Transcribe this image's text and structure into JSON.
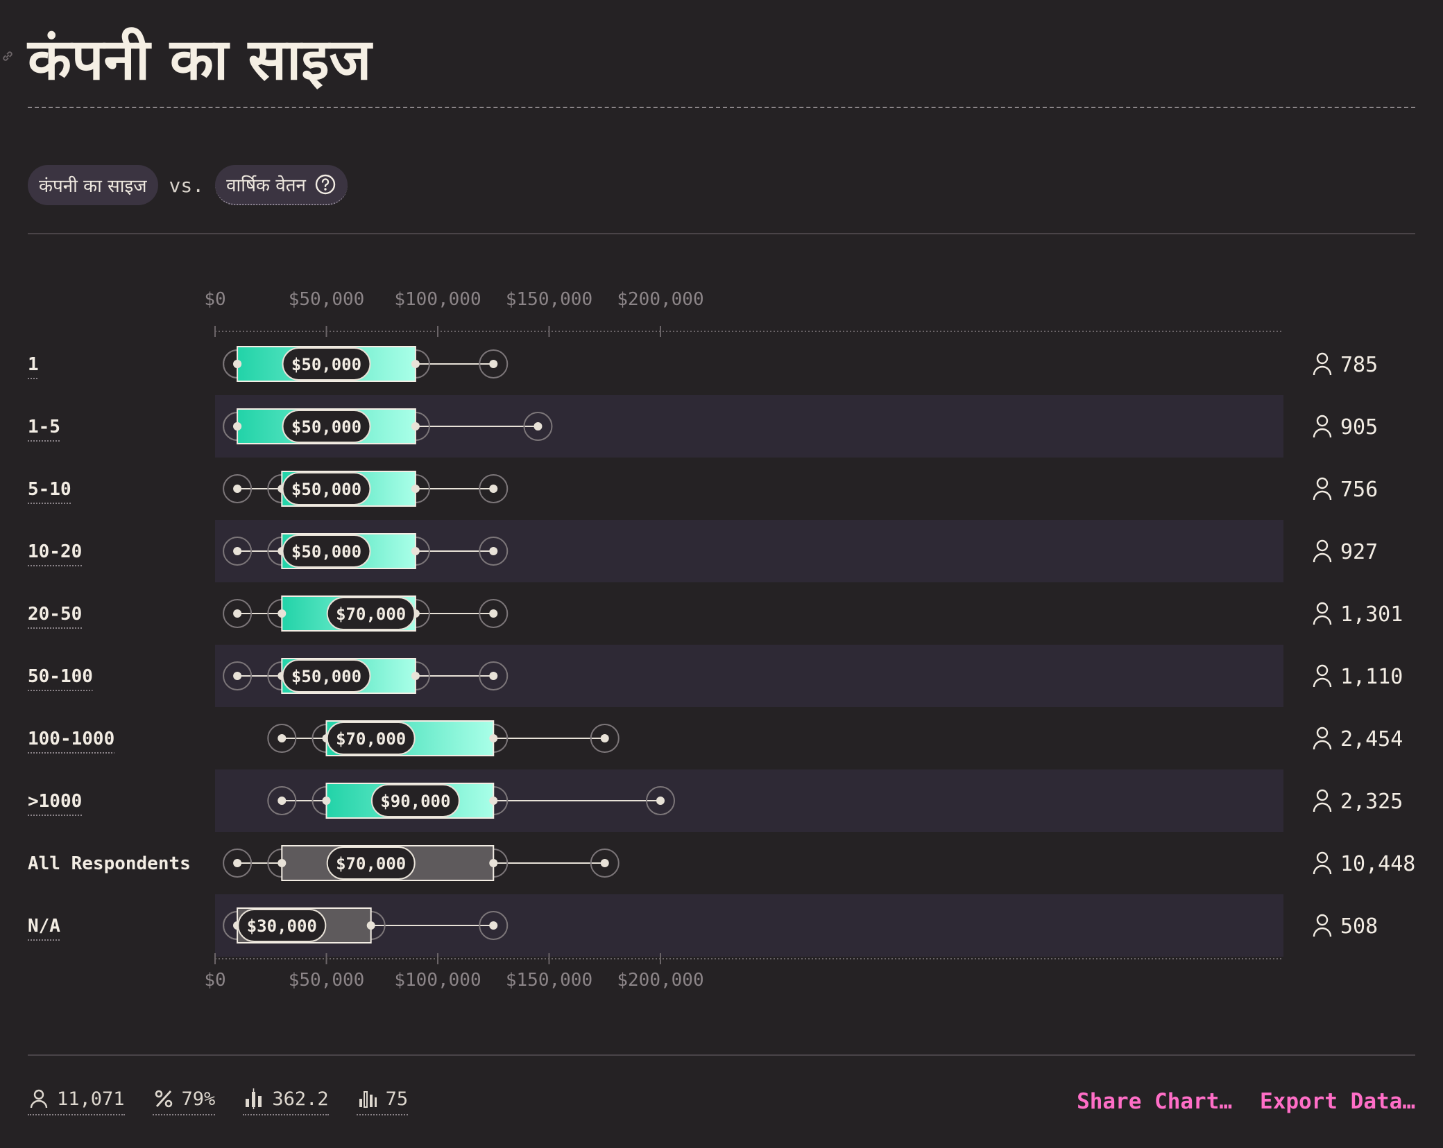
{
  "title": "कंपनी का साइज",
  "selector": {
    "category_label": "कंपनी का साइज",
    "vs": "vs.",
    "metric_label": "वार्षिक वेतन"
  },
  "colors": {
    "background": "#252224",
    "band": "#2e2935",
    "bar_start": "#22d3a8",
    "bar_end": "#a9ffe8",
    "neutral_bar": "#5e5a5c",
    "accent_link": "#ff6ec7"
  },
  "chart_data": {
    "type": "boxplot",
    "xlabel": "",
    "ylabel": "",
    "xlim": [
      0,
      240000
    ],
    "x_ticks": [
      0,
      50000,
      100000,
      150000,
      200000
    ],
    "x_tick_labels": [
      "$0",
      "$50,000",
      "$100,000",
      "$150,000",
      "$200,000"
    ],
    "alternating_bands": true,
    "rows": [
      {
        "label": "1",
        "whisker_low": 10000,
        "q1": 10000,
        "median": 50000,
        "q3": 90000,
        "whisker_high": 125000,
        "median_label": "$50,000",
        "count": "785",
        "style": "accent"
      },
      {
        "label": "1-5",
        "whisker_low": 10000,
        "q1": 10000,
        "median": 50000,
        "q3": 90000,
        "whisker_high": 145000,
        "median_label": "$50,000",
        "count": "905",
        "style": "accent"
      },
      {
        "label": "5-10",
        "whisker_low": 10000,
        "q1": 30000,
        "median": 50000,
        "q3": 90000,
        "whisker_high": 125000,
        "median_label": "$50,000",
        "count": "756",
        "style": "accent"
      },
      {
        "label": "10-20",
        "whisker_low": 10000,
        "q1": 30000,
        "median": 50000,
        "q3": 90000,
        "whisker_high": 125000,
        "median_label": "$50,000",
        "count": "927",
        "style": "accent"
      },
      {
        "label": "20-50",
        "whisker_low": 10000,
        "q1": 30000,
        "median": 70000,
        "q3": 90000,
        "whisker_high": 125000,
        "median_label": "$70,000",
        "count": "1,301",
        "style": "accent"
      },
      {
        "label": "50-100",
        "whisker_low": 10000,
        "q1": 30000,
        "median": 50000,
        "q3": 90000,
        "whisker_high": 125000,
        "median_label": "$50,000",
        "count": "1,110",
        "style": "accent"
      },
      {
        "label": "100-1000",
        "whisker_low": 30000,
        "q1": 50000,
        "median": 70000,
        "q3": 125000,
        "whisker_high": 175000,
        "median_label": "$70,000",
        "count": "2,454",
        "style": "accent"
      },
      {
        "label": ">1000",
        "whisker_low": 30000,
        "q1": 50000,
        "median": 90000,
        "q3": 125000,
        "whisker_high": 200000,
        "median_label": "$90,000",
        "count": "2,325",
        "style": "accent"
      },
      {
        "label": "All Respondents",
        "whisker_low": 10000,
        "q1": 30000,
        "median": 70000,
        "q3": 125000,
        "whisker_high": 175000,
        "median_label": "$70,000",
        "count": "10,448",
        "style": "neutral"
      },
      {
        "label": "N/A",
        "whisker_low": 10000,
        "q1": 10000,
        "median": 30000,
        "q3": 70000,
        "whisker_high": 125000,
        "median_label": "$30,000",
        "count": "508",
        "style": "neutral"
      }
    ]
  },
  "footer": {
    "stats": [
      {
        "icon": "person-icon",
        "value": "11,071"
      },
      {
        "icon": "percent-icon",
        "value": "79%"
      },
      {
        "icon": "mean-bars-icon",
        "value": "362.2"
      },
      {
        "icon": "bar-chart-icon",
        "value": "75"
      }
    ],
    "share_label": "Share Chart…",
    "export_label": "Export Data…"
  }
}
